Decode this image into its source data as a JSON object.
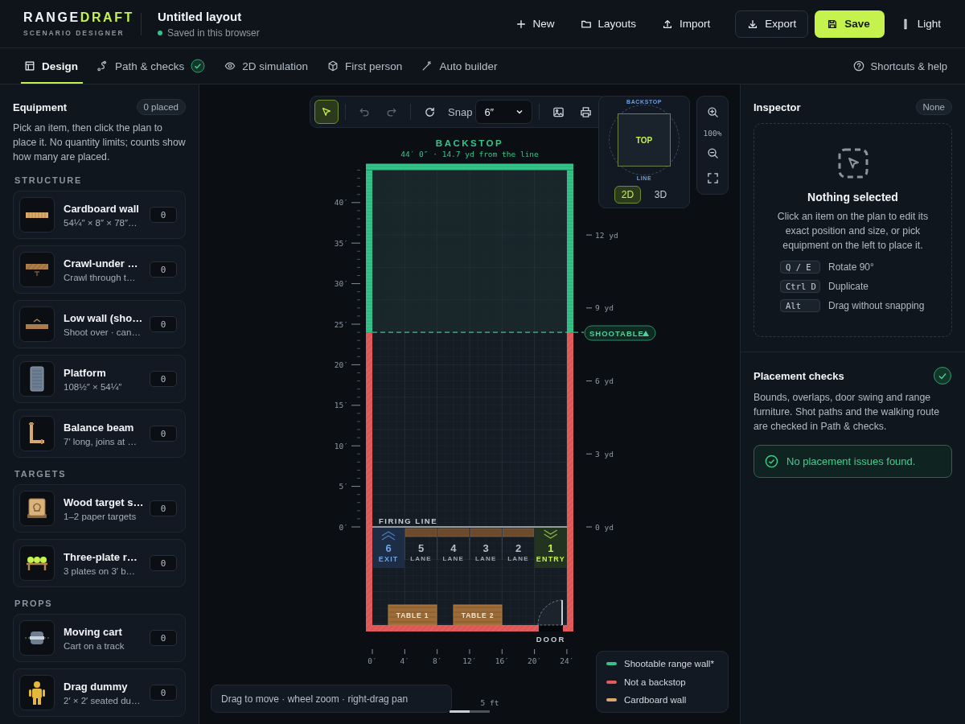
{
  "header": {
    "brand": {
      "first": "RANGE",
      "second": "DRAFT",
      "tagline": "SCENARIO DESIGNER"
    },
    "document": {
      "title": "Untitled layout",
      "status": "Saved in this browser"
    },
    "actions": [
      {
        "label": "New",
        "kind": "plain"
      },
      {
        "label": "Layouts",
        "kind": "plain"
      },
      {
        "label": "Import",
        "kind": "plain"
      },
      {
        "label": "Export",
        "kind": "outline"
      },
      {
        "label": "Save",
        "kind": "primary"
      },
      {
        "label": "Light",
        "kind": "plain"
      }
    ]
  },
  "tabs": [
    {
      "label": "Design",
      "selected": true,
      "passed": false
    },
    {
      "label": "Path & checks",
      "selected": false,
      "passed": true
    },
    {
      "label": "2D simulation",
      "selected": false,
      "passed": false
    },
    {
      "label": "First person",
      "selected": false,
      "passed": false
    },
    {
      "label": "Auto builder",
      "selected": false,
      "passed": false
    }
  ],
  "help_link": "Shortcuts & help",
  "equipment": {
    "title": "Equipment",
    "count": "0 placed",
    "description": "Pick an item, then click the plan to place it. No quantity limits; counts show how many are placed.",
    "groups": [
      {
        "title": "STRUCTURE",
        "items": [
          {
            "name": "Cardboard wall",
            "detail": "54¼″ × 8″ × 78″…",
            "count": "0"
          },
          {
            "name": "Crawl-under …",
            "detail": "Crawl through t…",
            "count": "0"
          },
          {
            "name": "Low wall (sho…",
            "detail": "Shoot over · can…",
            "count": "0"
          },
          {
            "name": "Platform",
            "detail": "108½″ × 54¼″",
            "count": "0"
          },
          {
            "name": "Balance beam",
            "detail": "7′ long, joins at …",
            "count": "0"
          }
        ]
      },
      {
        "title": "TARGETS",
        "items": [
          {
            "name": "Wood target s…",
            "detail": "1–2 paper targets",
            "count": "0"
          },
          {
            "name": "Three-plate r…",
            "detail": "3 plates on 3′ b…",
            "count": "0"
          }
        ]
      },
      {
        "title": "PROPS",
        "items": [
          {
            "name": "Moving cart",
            "detail": "Cart on a track",
            "count": "0"
          },
          {
            "name": "Drag dummy",
            "detail": "2′ × 2′ seated du…",
            "count": "0"
          }
        ]
      }
    ]
  },
  "toolbar": {
    "select_active": true,
    "snap_label": "Snap",
    "snap_value": "6″"
  },
  "view_cube": {
    "top_label": "BACKSTOP",
    "face": "TOP",
    "bottom_label": "LINE",
    "modes": [
      {
        "label": "2D",
        "selected": true
      },
      {
        "label": "3D",
        "selected": false
      }
    ]
  },
  "zoom": {
    "level_text": "100%"
  },
  "plan": {
    "backstop_title": "BACKSTOP",
    "backstop_subtitle": "44′ 0″ · 14.7 yd from the line",
    "left_axis": [
      "40′",
      "35′",
      "30′",
      "25′",
      "20′",
      "15′",
      "10′",
      "5′",
      "0′"
    ],
    "right_axis": [
      "12 yd",
      "9 yd",
      "6 yd",
      "3 yd",
      "0 yd"
    ],
    "bottom_axis": [
      "0′",
      "4′",
      "8′",
      "12′",
      "16′",
      "20′",
      "24′"
    ],
    "shootable_tag": "SHOOTABLE",
    "firing_line": "FIRING LINE",
    "lanes": [
      {
        "number": "6",
        "label": "EXIT",
        "kind": "exit"
      },
      {
        "number": "5",
        "label": "LANE",
        "kind": "lane"
      },
      {
        "number": "4",
        "label": "LANE",
        "kind": "lane"
      },
      {
        "number": "3",
        "label": "LANE",
        "kind": "lane"
      },
      {
        "number": "2",
        "label": "LANE",
        "kind": "lane"
      },
      {
        "number": "1",
        "label": "ENTRY",
        "kind": "entry"
      }
    ],
    "tables": [
      "TABLE 1",
      "TABLE 2"
    ],
    "door": "DOOR"
  },
  "hint": "Drag to move · wheel zoom · right-drag pan",
  "scale": "5 ft",
  "legend": [
    {
      "label": "Shootable range wall*",
      "color": "#34c48b"
    },
    {
      "label": "Not a backstop",
      "color": "#e25c5c"
    },
    {
      "label": "Cardboard wall",
      "color": "#d9a86c"
    }
  ],
  "inspector": {
    "title": "Inspector",
    "badge": "None",
    "heading": "Nothing selected",
    "text": "Click an item on the plan to edit its exact position and size, or pick equipment on the left to place it.",
    "shortcuts": [
      {
        "keys": "Q / E",
        "action": "Rotate 90°"
      },
      {
        "keys": "Ctrl D",
        "action": "Duplicate"
      },
      {
        "keys": "Alt",
        "action": "Drag without snapping"
      }
    ]
  },
  "checks": {
    "title": "Placement checks",
    "passed": true,
    "text": "Bounds, overlaps, door swing and range furniture. Shot paths and the walking route are checked in Path & checks.",
    "result": "No placement issues found."
  }
}
